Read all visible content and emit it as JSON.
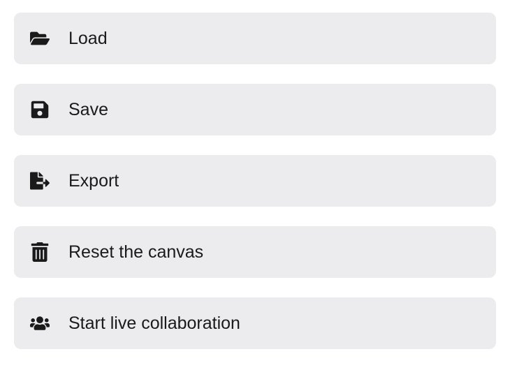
{
  "menu": {
    "items": [
      {
        "label": "Load",
        "icon": "folder-open-icon",
        "name": "menu-item-load"
      },
      {
        "label": "Save",
        "icon": "save-icon",
        "name": "menu-item-save"
      },
      {
        "label": "Export",
        "icon": "export-icon",
        "name": "menu-item-export"
      },
      {
        "label": "Reset the canvas",
        "icon": "trash-icon",
        "name": "menu-item-reset"
      },
      {
        "label": "Start live collaboration",
        "icon": "users-icon",
        "name": "menu-item-collaboration"
      }
    ]
  }
}
